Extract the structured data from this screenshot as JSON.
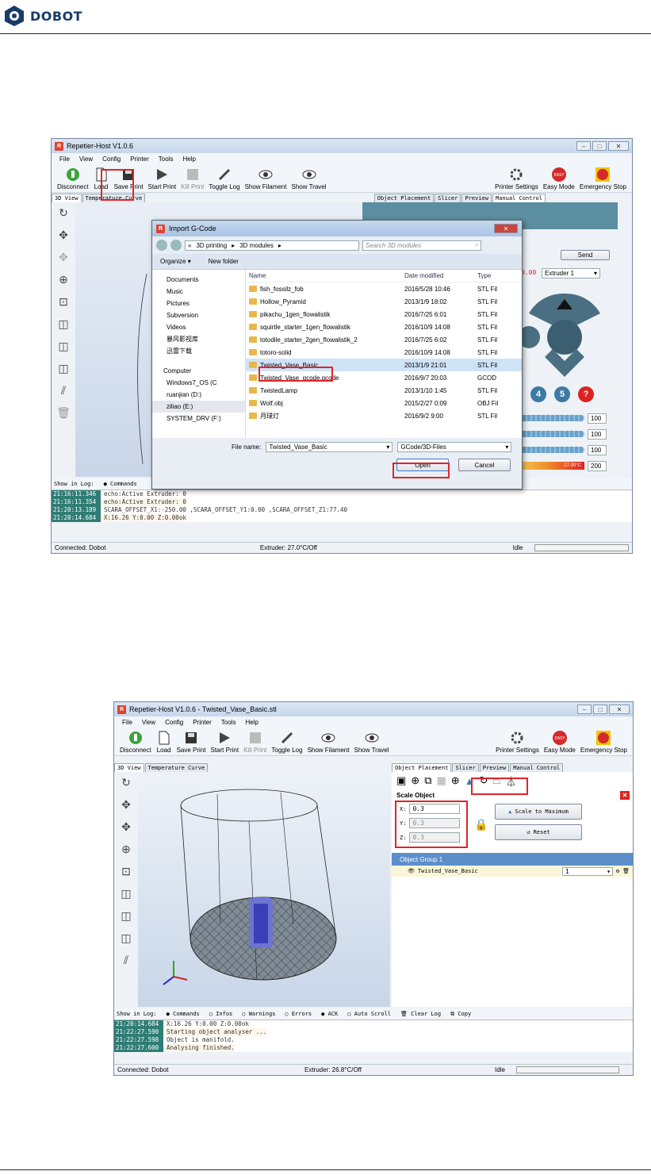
{
  "brand": {
    "name": "DOBOT"
  },
  "fig1": {
    "title": "Repetier-Host V1.0.6",
    "menu": [
      "File",
      "View",
      "Config",
      "Printer",
      "Tools",
      "Help"
    ],
    "toolbar": [
      "Disconnect",
      "Load",
      "Save Print",
      "Start Print",
      "Kill Print",
      "Toggle Log",
      "Show Filament",
      "Show Travel"
    ],
    "toolbar_right": [
      "Printer Settings",
      "Easy Mode",
      "Emergency Stop"
    ],
    "left_tabs": [
      "3D View",
      "Temperature Curve"
    ],
    "right_tabs": [
      "Object Placement",
      "Slicer",
      "Preview",
      "Manual Control"
    ],
    "send_label": "Send",
    "extruder_select": "Extruder 1",
    "temp_display": "0.00",
    "slider_values": [
      "100",
      "100",
      "100",
      "200"
    ],
    "slider_temp": "27.00°C",
    "num_buttons": [
      "4",
      "5",
      "?"
    ],
    "log_show_label": "Show in Log:",
    "log_options": [
      "Commands"
    ],
    "log_lines": [
      {
        "time": "21:16:11.346",
        "msg": "echo:Active Extruder: 0"
      },
      {
        "time": "21:16:11.354",
        "msg": "echo:Active Extruder: 0"
      },
      {
        "time": "21:20:13.189",
        "msg": "SCARA_OFFSET_X1:-250.00 ,SCARA_OFFSET_Y1:0.00 ,SCARA_OFFSET_Z1:77.40"
      },
      {
        "time": "21:20:14.684",
        "msg": "X:16.26 Y:0.00 Z:0.00ok"
      }
    ],
    "status": {
      "left": "Connected: Dobot",
      "middle": "Extruder: 27.0°C/Off",
      "right": "Idle"
    },
    "dialog": {
      "title": "Import G-Code",
      "breadcrumb": [
        "«",
        "3D printing",
        "3D modules"
      ],
      "search_placeholder": "Search 3D modules",
      "organize": "Organize",
      "new_folder": "New folder",
      "tree": [
        "Documents",
        "Music",
        "Pictures",
        "Subversion",
        "Videos",
        "暴风影视库",
        "迅雷下载",
        "Computer",
        "Windows7_OS (C",
        "ruanjian (D:)",
        "ziliao (E:)",
        "SYSTEM_DRV (F:)"
      ],
      "columns": [
        "Name",
        "Date modified",
        "Type"
      ],
      "files": [
        {
          "name": "fish_fossilz_fob",
          "date": "2016/5/28 10:46",
          "type": "STL Fil"
        },
        {
          "name": "Hollow_Pyramid",
          "date": "2013/1/9 18:02",
          "type": "STL Fil"
        },
        {
          "name": "pikachu_1gen_flowalistik",
          "date": "2016/7/25 6:01",
          "type": "STL Fil"
        },
        {
          "name": "squirtle_starter_1gen_flowalistik",
          "date": "2016/10/9 14:08",
          "type": "STL Fil"
        },
        {
          "name": "totodile_starter_2gen_flowalistik_2",
          "date": "2016/7/25 6:02",
          "type": "STL Fil"
        },
        {
          "name": "totoro-solid",
          "date": "2016/10/9 14:08",
          "type": "STL Fil"
        },
        {
          "name": "Twisted_Vase_Basic",
          "date": "2013/1/9 21:01",
          "type": "STL Fil"
        },
        {
          "name": "Twisted_Vase_gcode.gcode",
          "date": "2016/9/7 20:03",
          "type": "GCOD"
        },
        {
          "name": "TwistedLamp",
          "date": "2013/1/10 1:45",
          "type": "STL Fil"
        },
        {
          "name": "Wolf.obj",
          "date": "2015/2/27 0:09",
          "type": "OBJ Fil"
        },
        {
          "name": "月球灯",
          "date": "2016/9/2 9:00",
          "type": "STL Fil"
        }
      ],
      "filename_label": "File name:",
      "filename_value": "Twisted_Vase_Basic",
      "filter": "GCode/3D-Files",
      "open": "Open",
      "cancel": "Cancel"
    }
  },
  "fig2": {
    "title": "Repetier-Host V1.0.6 - Twisted_Vase_Basic.stl",
    "menu": [
      "File",
      "View",
      "Config",
      "Printer",
      "Tools",
      "Help"
    ],
    "toolbar": [
      "Disconnect",
      "Load",
      "Save Print",
      "Start Print",
      "Kill Print",
      "Toggle Log",
      "Show Filament",
      "Show Travel"
    ],
    "toolbar_right": [
      "Printer Settings",
      "Easy Mode",
      "Emergency Stop"
    ],
    "left_tabs": [
      "3D View",
      "Temperature Curve"
    ],
    "right_tabs": [
      "Object Placement",
      "Slicer",
      "Preview",
      "Manual Control"
    ],
    "scale_title": "Scale Object",
    "scale": {
      "x_label": "X:",
      "x": "0.3",
      "y_label": "Y:",
      "y": "0.3",
      "z_label": "Z:",
      "z": "0.3"
    },
    "scale_max": "Scale to Maximum",
    "reset": "Reset",
    "group": "Object Group 1",
    "object_name": "Twisted_Vase_Basic",
    "object_ext": "1",
    "log_show_label": "Show in Log:",
    "log_options": [
      "Commands",
      "Infos",
      "Warnings",
      "Errors",
      "ACK",
      "Auto Scroll",
      "Clear Log",
      "Copy"
    ],
    "log_lines": [
      {
        "time": "21:20:14.684",
        "msg": "X:16.26 Y:0.00 Z:0.00ok"
      },
      {
        "time": "21:22:27.590",
        "msg": "Starting object analyser ..."
      },
      {
        "time": "21:22:27.598",
        "msg": "Object is manifold."
      },
      {
        "time": "21:22:27.600",
        "msg": "Analysing finished."
      }
    ],
    "status": {
      "left": "Connected: Dobot",
      "middle": "Extruder: 26.8°C/Off",
      "right": "Idle"
    }
  }
}
